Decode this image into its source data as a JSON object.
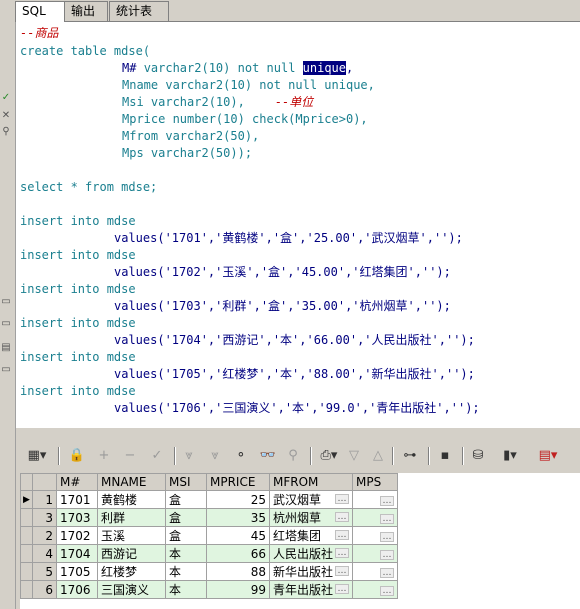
{
  "tabs": [
    "SQL",
    "输出",
    "统计表"
  ],
  "editor": {
    "comment_goods": "--商品",
    "create": "create table mdse(",
    "col1_name": "M#",
    "col1_type": "varchar2(10)",
    "col1_nn": "not null",
    "col1_unique": "unique",
    "col1_tail": ",",
    "col2": "Mname varchar2(10) not null unique,",
    "col3": "Msi varchar2(10),",
    "col3_comment": "--单位",
    "col4": "Mprice number(10) check(Mprice>0),",
    "col5": "Mfrom varchar2(50),",
    "col6": "Mps varchar2(50));",
    "select": "select * from mdse;",
    "insert_stmt": "insert into mdse",
    "values": [
      "values('1701','黄鹤楼','盒','25.00','武汉烟草','');",
      "values('1702','玉溪','盒','45.00','红塔集团','');",
      "values('1703','利群','盒','35.00','杭州烟草','');",
      "values('1704','西游记','本','66.00','人民出版社','');",
      "values('1705','红楼梦','本','88.00','新华出版社','');",
      "values('1706','三国演义','本','99.0','青年出版社','');"
    ]
  },
  "grid": {
    "headers": [
      "M#",
      "MNAME",
      "MSI",
      "MPRICE",
      "MFROM",
      "MPS"
    ],
    "rows": [
      {
        "rn": "1",
        "m": "1701",
        "name": "黄鹤楼",
        "si": "盒",
        "price": "25",
        "from": "武汉烟草"
      },
      {
        "rn": "3",
        "m": "1703",
        "name": "利群",
        "si": "盒",
        "price": "35",
        "from": "杭州烟草"
      },
      {
        "rn": "2",
        "m": "1702",
        "name": "玉溪",
        "si": "盒",
        "price": "45",
        "from": "红塔集团"
      },
      {
        "rn": "4",
        "m": "1704",
        "name": "西游记",
        "si": "本",
        "price": "66",
        "from": "人民出版社"
      },
      {
        "rn": "5",
        "m": "1705",
        "name": "红楼梦",
        "si": "本",
        "price": "88",
        "from": "新华出版社"
      },
      {
        "rn": "6",
        "m": "1706",
        "name": "三国演义",
        "si": "本",
        "price": "99",
        "from": "青年出版社"
      }
    ],
    "ellipsis": "…"
  }
}
